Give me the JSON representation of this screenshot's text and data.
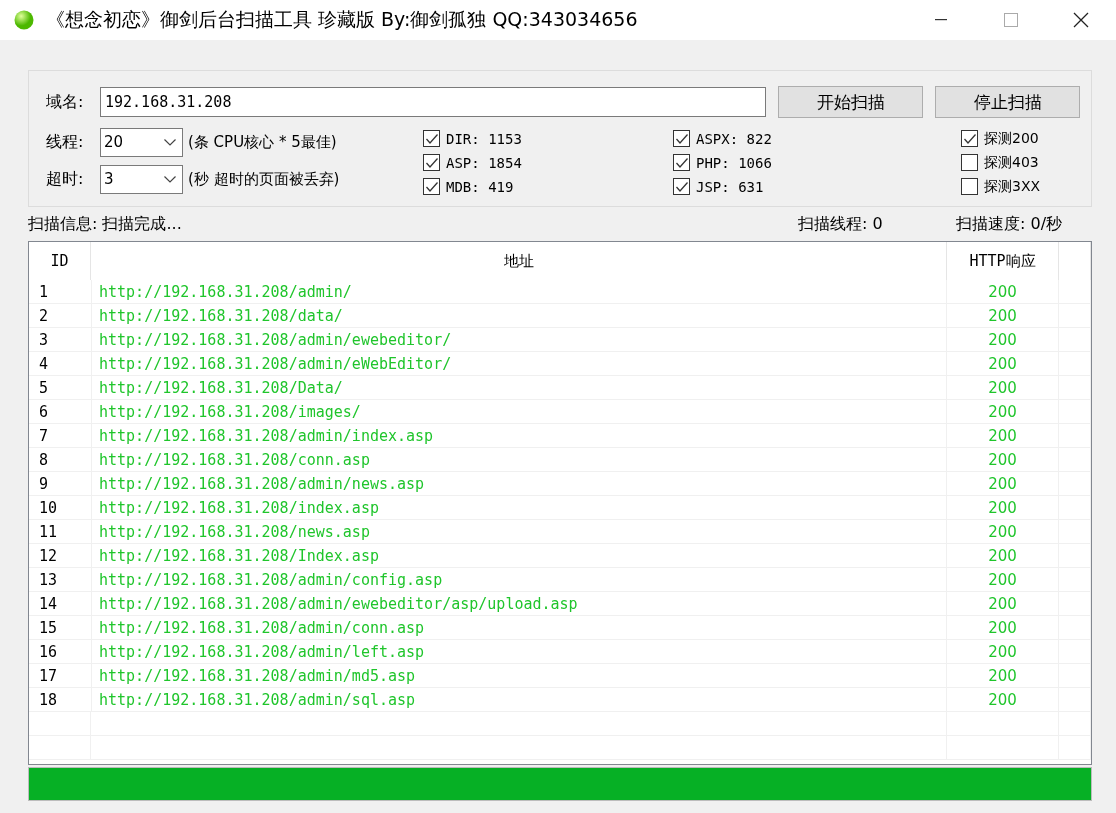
{
  "window": {
    "title": "《想念初恋》御剑后台扫描工具 珍藏版 By:御剑孤独 QQ:343034656"
  },
  "form": {
    "domain_label": "域名:",
    "domain_value": "192.168.31.208",
    "buttons": [
      "开始扫描",
      "停止扫描"
    ],
    "threads_label": "线程:",
    "threads_value": "20",
    "threads_hint": "(条 CPU核心 * 5最佳)",
    "timeout_label": "超时:",
    "timeout_value": "3",
    "timeout_hint": "(秒 超时的页面被丢弃)",
    "file_types": [
      {
        "label": "DIR: 1153",
        "checked": true
      },
      {
        "label": "ASP: 1854",
        "checked": true
      },
      {
        "label": "MDB: 419",
        "checked": true
      },
      {
        "label": "ASPX: 822",
        "checked": true
      },
      {
        "label": "PHP: 1066",
        "checked": true
      },
      {
        "label": "JSP: 631",
        "checked": true
      }
    ],
    "probes": [
      {
        "label": "探测200",
        "checked": true
      },
      {
        "label": "探测403",
        "checked": false
      },
      {
        "label": "探测3XX",
        "checked": false
      }
    ]
  },
  "status": {
    "info": "扫描信息: 扫描完成...",
    "threads": "扫描线程: 0",
    "speed": "扫描速度: 0/秒"
  },
  "table": {
    "columns": [
      "ID",
      "地址",
      "HTTP响应"
    ],
    "rows": [
      [
        "1",
        "http://192.168.31.208/admin/",
        "200"
      ],
      [
        "2",
        "http://192.168.31.208/data/",
        "200"
      ],
      [
        "3",
        "http://192.168.31.208/admin/ewebeditor/",
        "200"
      ],
      [
        "4",
        "http://192.168.31.208/admin/eWebEditor/",
        "200"
      ],
      [
        "5",
        "http://192.168.31.208/Data/",
        "200"
      ],
      [
        "6",
        "http://192.168.31.208/images/",
        "200"
      ],
      [
        "7",
        "http://192.168.31.208/admin/index.asp",
        "200"
      ],
      [
        "8",
        "http://192.168.31.208/conn.asp",
        "200"
      ],
      [
        "9",
        "http://192.168.31.208/admin/news.asp",
        "200"
      ],
      [
        "10",
        "http://192.168.31.208/index.asp",
        "200"
      ],
      [
        "11",
        "http://192.168.31.208/news.asp",
        "200"
      ],
      [
        "12",
        "http://192.168.31.208/Index.asp",
        "200"
      ],
      [
        "13",
        "http://192.168.31.208/admin/config.asp",
        "200"
      ],
      [
        "14",
        "http://192.168.31.208/admin/ewebeditor/asp/upload.asp",
        "200"
      ],
      [
        "15",
        "http://192.168.31.208/admin/conn.asp",
        "200"
      ],
      [
        "16",
        "http://192.168.31.208/admin/left.asp",
        "200"
      ],
      [
        "17",
        "http://192.168.31.208/admin/md5.asp",
        "200"
      ],
      [
        "18",
        "http://192.168.31.208/admin/sql.asp",
        "200"
      ]
    ]
  },
  "progress": {
    "level": 1
  }
}
